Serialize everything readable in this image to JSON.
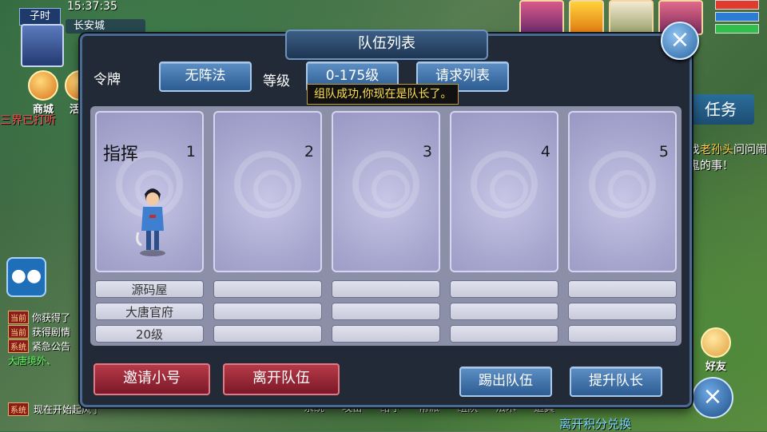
{
  "hud": {
    "time_of_day": "子时",
    "clock": "15:37:35",
    "city": "长安城",
    "shop_label": "商城",
    "activity_label": "活动",
    "news_text": "三界已打听",
    "chat": [
      {
        "channel": "当前",
        "text": "你获得了"
      },
      {
        "channel": "当前",
        "text": "获得剧情"
      },
      {
        "channel": "系统",
        "text": "紧急公告"
      },
      {
        "channel": "",
        "text": "大唐境外、"
      }
    ],
    "bottom_chat": {
      "channel": "系统",
      "text": "现在开始起风了"
    },
    "task_tab": "任务",
    "task_text_before": "找",
    "task_npc": "老孙头",
    "task_text_after": "问问闹鬼的事！",
    "friend_label": "好友",
    "bottom_menu": [
      "系统",
      "攻击",
      "给予",
      "帮派",
      "组队",
      "法术",
      "道具"
    ],
    "bottom_banner": "离开积分兑换",
    "colors": {
      "hp": "#e23b2e",
      "mp": "#2c7bd6",
      "exp": "#2fbf4a"
    }
  },
  "dialog": {
    "title": "队伍列表",
    "token_label": "令牌",
    "formation_button": "无阵法",
    "level_label": "等级",
    "level_range_button": "0-175级",
    "request_list_button": "请求列表",
    "tooltip": "组队成功,你现在是队长了。",
    "leader_tag": "指挥",
    "slots": [
      {
        "num": "1",
        "name": "源码屋",
        "school": "大唐官府",
        "level": "20级",
        "filled": true
      },
      {
        "num": "2",
        "name": "",
        "school": "",
        "level": "",
        "filled": false
      },
      {
        "num": "3",
        "name": "",
        "school": "",
        "level": "",
        "filled": false
      },
      {
        "num": "4",
        "name": "",
        "school": "",
        "level": "",
        "filled": false
      },
      {
        "num": "5",
        "name": "",
        "school": "",
        "level": "",
        "filled": false
      }
    ],
    "invite_button": "邀请小号",
    "leave_button": "离开队伍",
    "kick_button": "踢出队伍",
    "promote_button": "提升队长",
    "close_icon": "close-icon"
  }
}
